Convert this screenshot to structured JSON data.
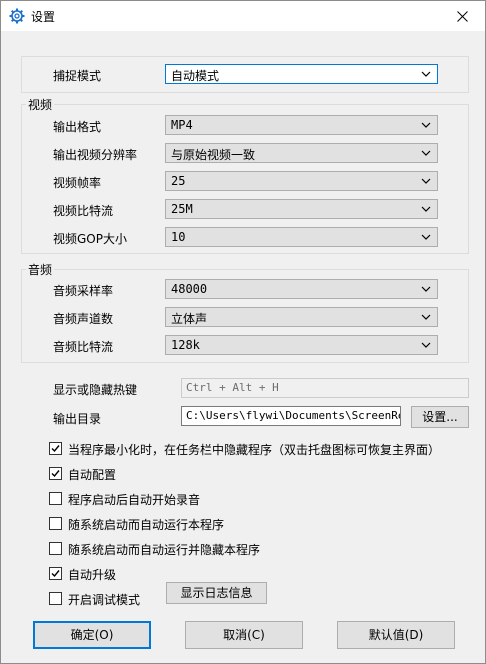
{
  "window": {
    "title": "设置",
    "close_icon": "close-icon",
    "settings_icon": "gear-icon"
  },
  "capture": {
    "label": "捕捉模式",
    "value": "自动模式"
  },
  "video": {
    "title": "视频",
    "format": {
      "label": "输出格式",
      "value": "MP4"
    },
    "resolution": {
      "label": "输出视频分辨率",
      "value": "与原始视频一致"
    },
    "framerate": {
      "label": "视频帧率",
      "value": "25"
    },
    "bitrate": {
      "label": "视频比特流",
      "value": "25M"
    },
    "gop": {
      "label": "视频GOP大小",
      "value": "10"
    }
  },
  "audio": {
    "title": "音频",
    "samplerate": {
      "label": "音频采样率",
      "value": "48000"
    },
    "channels": {
      "label": "音频声道数",
      "value": "立体声"
    },
    "bitrate": {
      "label": "音频比特流",
      "value": "128k"
    }
  },
  "hotkey": {
    "label": "显示或隐藏热键",
    "value": "Ctrl + Alt + H"
  },
  "output": {
    "label": "输出目录",
    "value": "C:\\Users\\flywi\\Documents\\ScreenRecor",
    "settings_button": "设置..."
  },
  "options": [
    {
      "label": "当程序最小化时，在任务栏中隐藏程序（双击托盘图标可恢复主界面）",
      "checked": true
    },
    {
      "label": "自动配置",
      "checked": true
    },
    {
      "label": "程序启动后自动开始录音",
      "checked": false
    },
    {
      "label": "随系统启动而自动运行本程序",
      "checked": false
    },
    {
      "label": "随系统启动而自动运行并隐藏本程序",
      "checked": false
    },
    {
      "label": "自动升级",
      "checked": true
    },
    {
      "label": "开启调试模式",
      "checked": false
    }
  ],
  "log_button": "显示日志信息",
  "footer": {
    "ok": "确定(O)",
    "cancel": "取消(C)",
    "default": "默认值(D)"
  }
}
